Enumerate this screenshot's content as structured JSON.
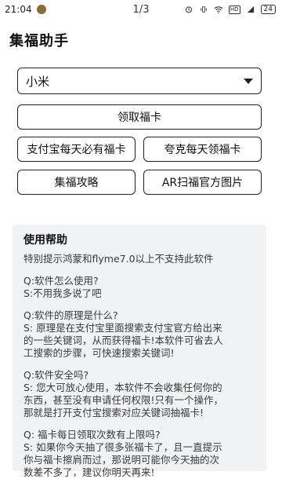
{
  "status_bar": {
    "time": "21:04",
    "page_indicator": "1/3",
    "hd": "HD",
    "battery": "24"
  },
  "app": {
    "title": "集福助手"
  },
  "select": {
    "value": "小米"
  },
  "buttons": {
    "receive_card": "领取福卡",
    "alipay_daily": "支付宝每天必有福卡",
    "quark_daily": "夸克每天领福卡",
    "strategy": "集福攻略",
    "ar_scan": "AR扫福官方图片"
  },
  "help": {
    "title": "使用帮助",
    "note": "特别提示鸿蒙和flyme7.0以上不支持此软件",
    "q1": "Q:软件怎么使用?",
    "a1": "S:不用我多说了吧",
    "q2": "Q:软件的原理是什么?",
    "a2_lines": [
      "S: 原理是在支付宝里面搜索支付宝官方给出来",
      "的一些关键词，从而获得福卡!本软件可省去人",
      "工搜索的步骤，可快速搜索关键词!"
    ],
    "q3": "Q:软件安全吗?",
    "a3_lines": [
      "S: 您大可放心使用，本软件不会收集任何你的",
      "东西，甚至没有申请任何权限!只有一个操作，",
      "那就是打开支付宝搜索对应关键词抽福卡!"
    ],
    "q4": "Q: 福卡每日领取次数有上限吗?",
    "a4_lines": [
      "S: 如果你今天抽了很多张福卡了，且一直提示",
      "你与福卡擦肩而过，那说明可能你今天抽的次",
      "数差不多了，建议你明天再来!"
    ]
  }
}
